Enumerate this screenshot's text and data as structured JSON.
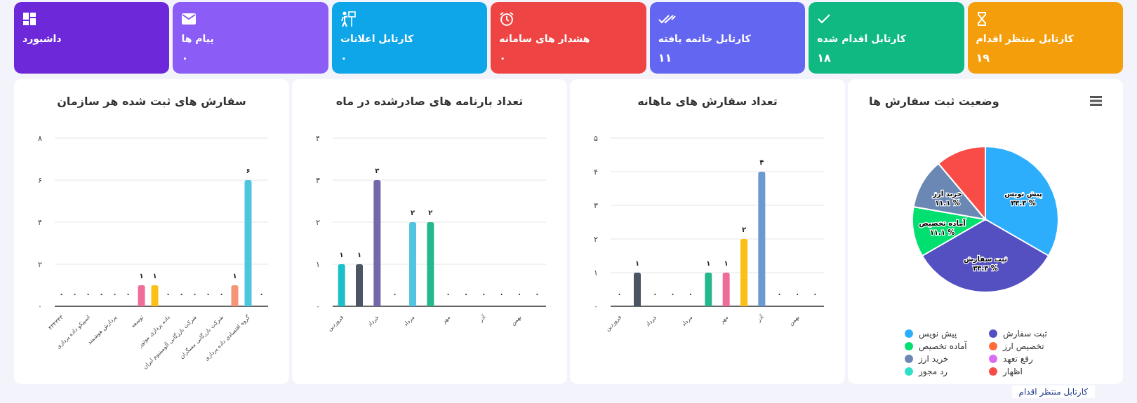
{
  "cards": [
    {
      "title": "کارتابل منتظر اقدام",
      "count": "۱۹",
      "color": "#f59e0b",
      "kind": "pending"
    },
    {
      "title": "کارتابل اقدام شده",
      "count": "۱۸",
      "color": "#10b981",
      "kind": "done"
    },
    {
      "title": "کارتابل خاتمه یافته",
      "count": "۱۱",
      "color": "#6366f1",
      "kind": "closed"
    },
    {
      "title": "هشدار های سامانه",
      "count": "۰",
      "color": "#ef4444",
      "kind": "alert"
    },
    {
      "title": "کارتابل اعلانات",
      "count": "۰",
      "color": "#0ea5e9",
      "kind": "notice"
    },
    {
      "title": "پیام ها",
      "count": "۰",
      "color": "#8b5cf6",
      "kind": "messages"
    },
    {
      "title": "داشبورد",
      "color": "#6d28d9",
      "kind": "dashboard"
    }
  ],
  "charts": [
    {
      "title": "وضعیت ثبت سفارش ها",
      "menu": true,
      "chart_data": {
        "type": "pie",
        "categories": [
          "پیش نویس",
          "ثبت سفارش",
          "آماده تخصیص",
          "تخصیص ارز",
          "خرید ارز",
          "رفع تعهد",
          "رد مجوز",
          "اظهار"
        ],
        "values": [
          33.3,
          33.3,
          11.1,
          0,
          11.1,
          0,
          0,
          11.1
        ],
        "data_labels": true,
        "legend": true,
        "colors": [
          "#2daefd",
          "#5450c2",
          "#00e070",
          "#ff6c3a",
          "#6b88b5",
          "#d86cf2",
          "#2ee0c8",
          "#f94c46"
        ],
        "value_labels": [
          "۳۳.۳ %",
          "۳۳.۳ %",
          "۱۱.۱ %",
          null,
          "۱۱.۱ %",
          null,
          null,
          null
        ]
      }
    },
    {
      "title": "تعداد سفارش های ماهانه",
      "chart_data": {
        "type": "bar",
        "values": [
          0,
          1,
          0,
          0,
          0,
          1,
          1,
          2,
          4,
          0,
          0,
          0
        ],
        "colors": [
          null,
          "#4b5563",
          null,
          null,
          null,
          "#25b88e",
          "#f06d99",
          "#fbbf18",
          "#6a9ad0",
          null,
          null,
          null
        ],
        "value_labels": [
          "۰",
          "۱",
          "۰",
          "۰",
          "۰",
          "۱",
          "۱",
          "۲",
          "۴",
          "۰",
          "۰",
          "۰"
        ],
        "ylim": [
          0,
          5
        ],
        "grid": true,
        "yticks": [
          {
            "value": 0,
            "label": "۰"
          },
          {
            "value": 1,
            "label": "۱"
          },
          {
            "value": 2,
            "label": "۲"
          },
          {
            "value": 3,
            "label": "۳"
          },
          {
            "value": 4,
            "label": "۴"
          },
          {
            "value": 5,
            "label": "۵"
          }
        ],
        "categories": [
          "فروردین",
          null,
          "خرداد",
          null,
          "مرداد",
          null,
          "مهر",
          null,
          "آذر",
          null,
          "بهمن",
          null
        ]
      }
    },
    {
      "title": "تعداد بارنامه های صادرشده در ماه",
      "chart_data": {
        "type": "bar",
        "values": [
          1,
          1,
          3,
          0,
          2,
          2,
          0,
          0,
          0,
          0,
          0,
          0
        ],
        "colors": [
          "#1bbfc8",
          "#4b5563",
          "#7467ab",
          null,
          "#52c4e0",
          "#25b88e",
          null,
          null,
          null,
          null,
          null,
          null
        ],
        "value_labels": [
          "۱",
          "۱",
          "۳",
          "۰",
          "۲",
          "۲",
          "۰",
          "۰",
          "۰",
          "۰",
          "۰",
          "۰"
        ],
        "ylim": [
          0,
          4
        ],
        "grid": true,
        "yticks": [
          {
            "value": 0,
            "label": "۰"
          },
          {
            "value": 1,
            "label": "۱"
          },
          {
            "value": 2,
            "label": "۲"
          },
          {
            "value": 3,
            "label": "۳"
          },
          {
            "value": 4,
            "label": "۴"
          }
        ],
        "categories": [
          "فروردین",
          null,
          "خرداد",
          null,
          "مرداد",
          null,
          "مهر",
          null,
          "آذر",
          null,
          "بهمن",
          null
        ]
      }
    },
    {
      "title": "سفارش های ثبت شده هر سازمان",
      "chart_data": {
        "type": "bar",
        "values": [
          0,
          0,
          0,
          0,
          0,
          0,
          1,
          1,
          0,
          0,
          0,
          0,
          0,
          1,
          6,
          0
        ],
        "colors": [
          null,
          null,
          null,
          null,
          null,
          null,
          "#f06d99",
          "#fbbf18",
          null,
          null,
          null,
          null,
          null,
          "#f59477",
          "#4fc6e0",
          null
        ],
        "value_labels": [
          "۰",
          "۰",
          "۰",
          "۰",
          "۰",
          "۰",
          "۱",
          "۱",
          "۰",
          "۰",
          "۰",
          "۰",
          "۰",
          "۱",
          "۶",
          "۰"
        ],
        "ylim": [
          0,
          8
        ],
        "grid": true,
        "yticks": [
          {
            "value": 0,
            "label": "۰"
          },
          {
            "value": 2,
            "label": "۲"
          },
          {
            "value": 4,
            "label": "۴"
          },
          {
            "value": 6,
            "label": "۶"
          },
          {
            "value": 8,
            "label": "۸"
          }
        ],
        "categories": [
          "۴۳۴۳۴۳",
          null,
          "اسپیکو داده پردازی",
          null,
          "پردازش هوشمند",
          null,
          "توسعه",
          null,
          "داده پردازی موتور",
          null,
          "شرکت بازرگانی آلومینیوم ایران",
          null,
          "شرکت بازرگانی مسگران",
          null,
          "گروه اقتصادی داده پردازی",
          null
        ]
      }
    }
  ],
  "tooltip": "کارتابل منتظر اقدام"
}
